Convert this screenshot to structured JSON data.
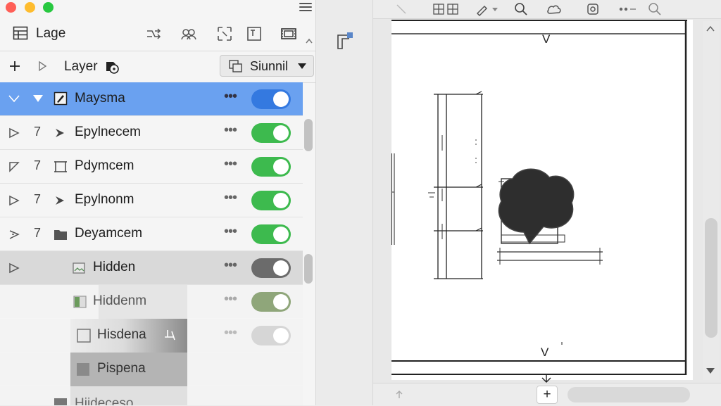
{
  "panel": {
    "title": "Lage",
    "toolbar_label": "Layer",
    "mode_select": {
      "label": "Siunnil"
    }
  },
  "layers": [
    {
      "name": "Maysma",
      "num": "",
      "selected": true,
      "toggle": "on"
    },
    {
      "name": "Epylnecem",
      "num": "7",
      "selected": false,
      "toggle": "on"
    },
    {
      "name": "Pdymcem",
      "num": "7",
      "selected": false,
      "toggle": "on"
    },
    {
      "name": "Epylnonm",
      "num": "7",
      "selected": false,
      "toggle": "on"
    },
    {
      "name": "Deyamcem",
      "num": "7",
      "selected": false,
      "toggle": "on"
    },
    {
      "name": "Hidden",
      "num": "",
      "selected": false,
      "toggle": "dark"
    },
    {
      "name": "Hiddenm",
      "num": "",
      "selected": false,
      "toggle": "olive"
    },
    {
      "name": "Hisdena",
      "num": "",
      "selected": false,
      "toggle": "light"
    },
    {
      "name": "Pispena",
      "num": "",
      "selected": false,
      "toggle": "none"
    },
    {
      "name": "Hiideceso",
      "num": "",
      "selected": false,
      "toggle": "none"
    }
  ],
  "canvas": {
    "mark_top": "V",
    "mark_bottom": "V"
  },
  "bottom_bar": {
    "add_label": "+"
  },
  "colors": {
    "selection": "#6aa1f0",
    "toggle_on_blue": "#3479e0",
    "toggle_on_green": "#3dba4e",
    "toggle_dark": "#6b6b6b",
    "toggle_olive": "#8fa67a",
    "toggle_light": "#d6d6d6"
  }
}
